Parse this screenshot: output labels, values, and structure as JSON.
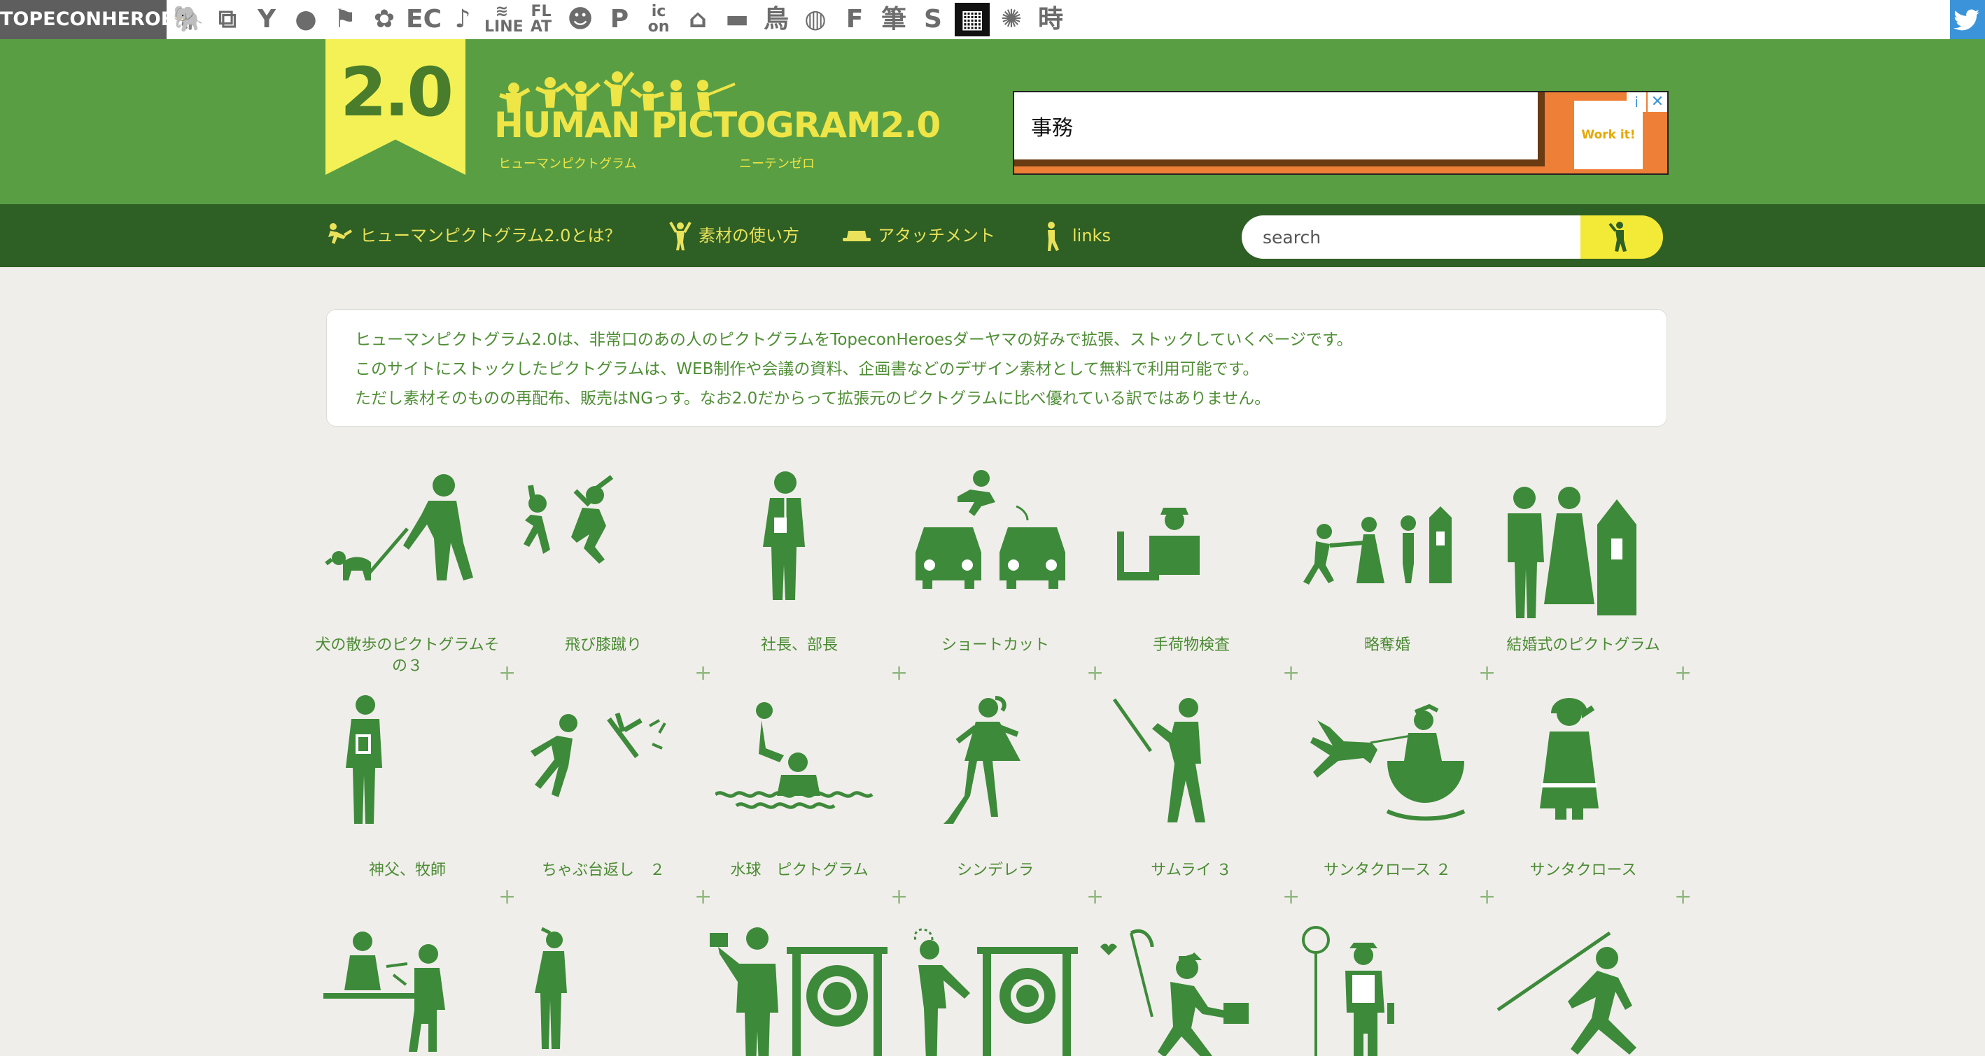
{
  "topbar": {
    "brand": "TOPECONHEROES",
    "icons": [
      {
        "name": "elephant-icon",
        "glyph": "🐘"
      },
      {
        "name": "windows-icon",
        "glyph": "⧉"
      },
      {
        "name": "figure-icon",
        "glyph": "Y"
      },
      {
        "name": "speech-bubble-icon",
        "glyph": "●"
      },
      {
        "name": "flag-icon",
        "glyph": "⚑"
      },
      {
        "name": "flower-icon",
        "glyph": "✿"
      },
      {
        "name": "ec-icon",
        "glyph": "EC"
      },
      {
        "name": "music-note-icon",
        "glyph": "♪"
      },
      {
        "name": "line-icon",
        "glyph": "≋ LINE"
      },
      {
        "name": "flat-icon",
        "glyph": "FL AT"
      },
      {
        "name": "smiley-icon",
        "glyph": "☻"
      },
      {
        "name": "parking-icon",
        "glyph": "P"
      },
      {
        "name": "icon-on-icon",
        "glyph": "ic on"
      },
      {
        "name": "house-icon",
        "glyph": "⌂"
      },
      {
        "name": "bar-icon",
        "glyph": "▬"
      },
      {
        "name": "bird-kanji-icon",
        "glyph": "鳥"
      },
      {
        "name": "circle-pattern-icon",
        "glyph": "◍"
      },
      {
        "name": "f-icon",
        "glyph": "F"
      },
      {
        "name": "brush-kanji-icon",
        "glyph": "筆"
      },
      {
        "name": "s-icon",
        "glyph": "S"
      },
      {
        "name": "grid-icon",
        "glyph": "▦"
      },
      {
        "name": "starburst-icon",
        "glyph": "✺"
      },
      {
        "name": "time-kanji-icon",
        "glyph": "時"
      }
    ],
    "twitter_icon": "twitter-icon"
  },
  "header": {
    "badge": "2.0",
    "logo_title": "HUMAN PICTOGRAM2.0",
    "logo_sub_left": "ヒューマンピクトグラム",
    "logo_sub_right": "ニーテンゼロ"
  },
  "ad": {
    "text": "事務",
    "logo_text": "Work it!",
    "info": "i",
    "close": "✕"
  },
  "nav": {
    "items": [
      {
        "label": "ヒューマンピクトグラム2.0とは？"
      },
      {
        "label": "素材の使い方"
      },
      {
        "label": "アタッチメント"
      },
      {
        "label": "links"
      }
    ],
    "search_placeholder": "search"
  },
  "intro": {
    "lines": [
      "ヒューマンピクトグラム2.0は、非常口のあの人のピクトグラムをTopeconHeroesダーヤマの好みで拡張、ストックしていくページです。",
      "このサイトにストックしたピクトグラムは、WEB制作や会議の資料、企画書などのデザイン素材として無料で利用可能です。",
      "ただし素材そのものの再配布、販売はNGっす。なお2.0だからって拡張元のピクトグラムに比べ優れている訳ではありません。"
    ]
  },
  "grid": {
    "row1": [
      {
        "caption": "犬の散歩のピクトグラムその３"
      },
      {
        "caption": "飛び膝蹴り"
      },
      {
        "caption": "社長、部長"
      },
      {
        "caption": "ショートカット"
      },
      {
        "caption": "手荷物検査"
      },
      {
        "caption": "略奪婚"
      },
      {
        "caption": "結婚式のピクトグラム"
      }
    ],
    "row2": [
      {
        "caption": "神父、牧師"
      },
      {
        "caption": "ちゃぶ台返し　２"
      },
      {
        "caption": "水球　ピクトグラム"
      },
      {
        "caption": "シンデレラ"
      },
      {
        "caption": "サムライ ３"
      },
      {
        "caption": "サンタクロース ２"
      },
      {
        "caption": "サンタクロース"
      }
    ],
    "plus": "+"
  },
  "colors": {
    "green": "#5a9e43",
    "dark_green": "#2e5f24",
    "yellow": "#f4f156",
    "pictogram": "#3d8a3a"
  }
}
